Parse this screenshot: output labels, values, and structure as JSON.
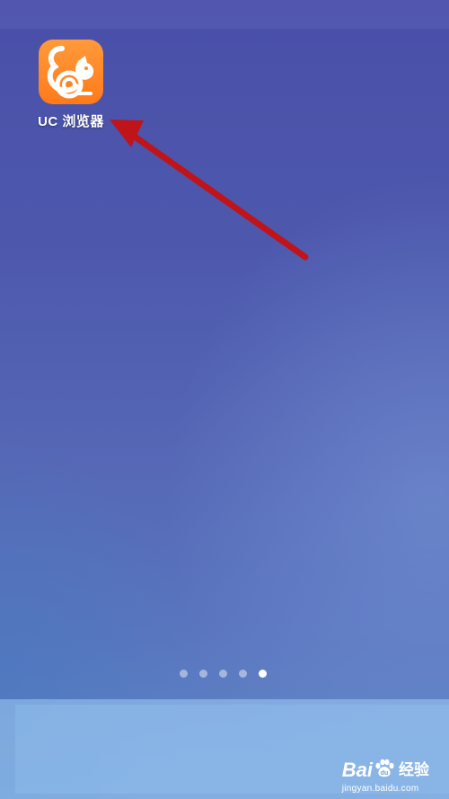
{
  "home_screen": {
    "apps": [
      {
        "label": "UC 浏览器",
        "icon": "uc-browser-squirrel-icon",
        "color": "#ff8a25"
      }
    ],
    "page_indicator": {
      "total_pages": 5,
      "active_page": 5
    },
    "annotation": {
      "type": "arrow",
      "color": "#c0141b",
      "points_to": "UC 浏览器"
    }
  },
  "watermark": {
    "brand_part_1": "Bai",
    "brand_part_2": "du",
    "suffix": "经验",
    "url": "jingyan.baidu.com"
  }
}
